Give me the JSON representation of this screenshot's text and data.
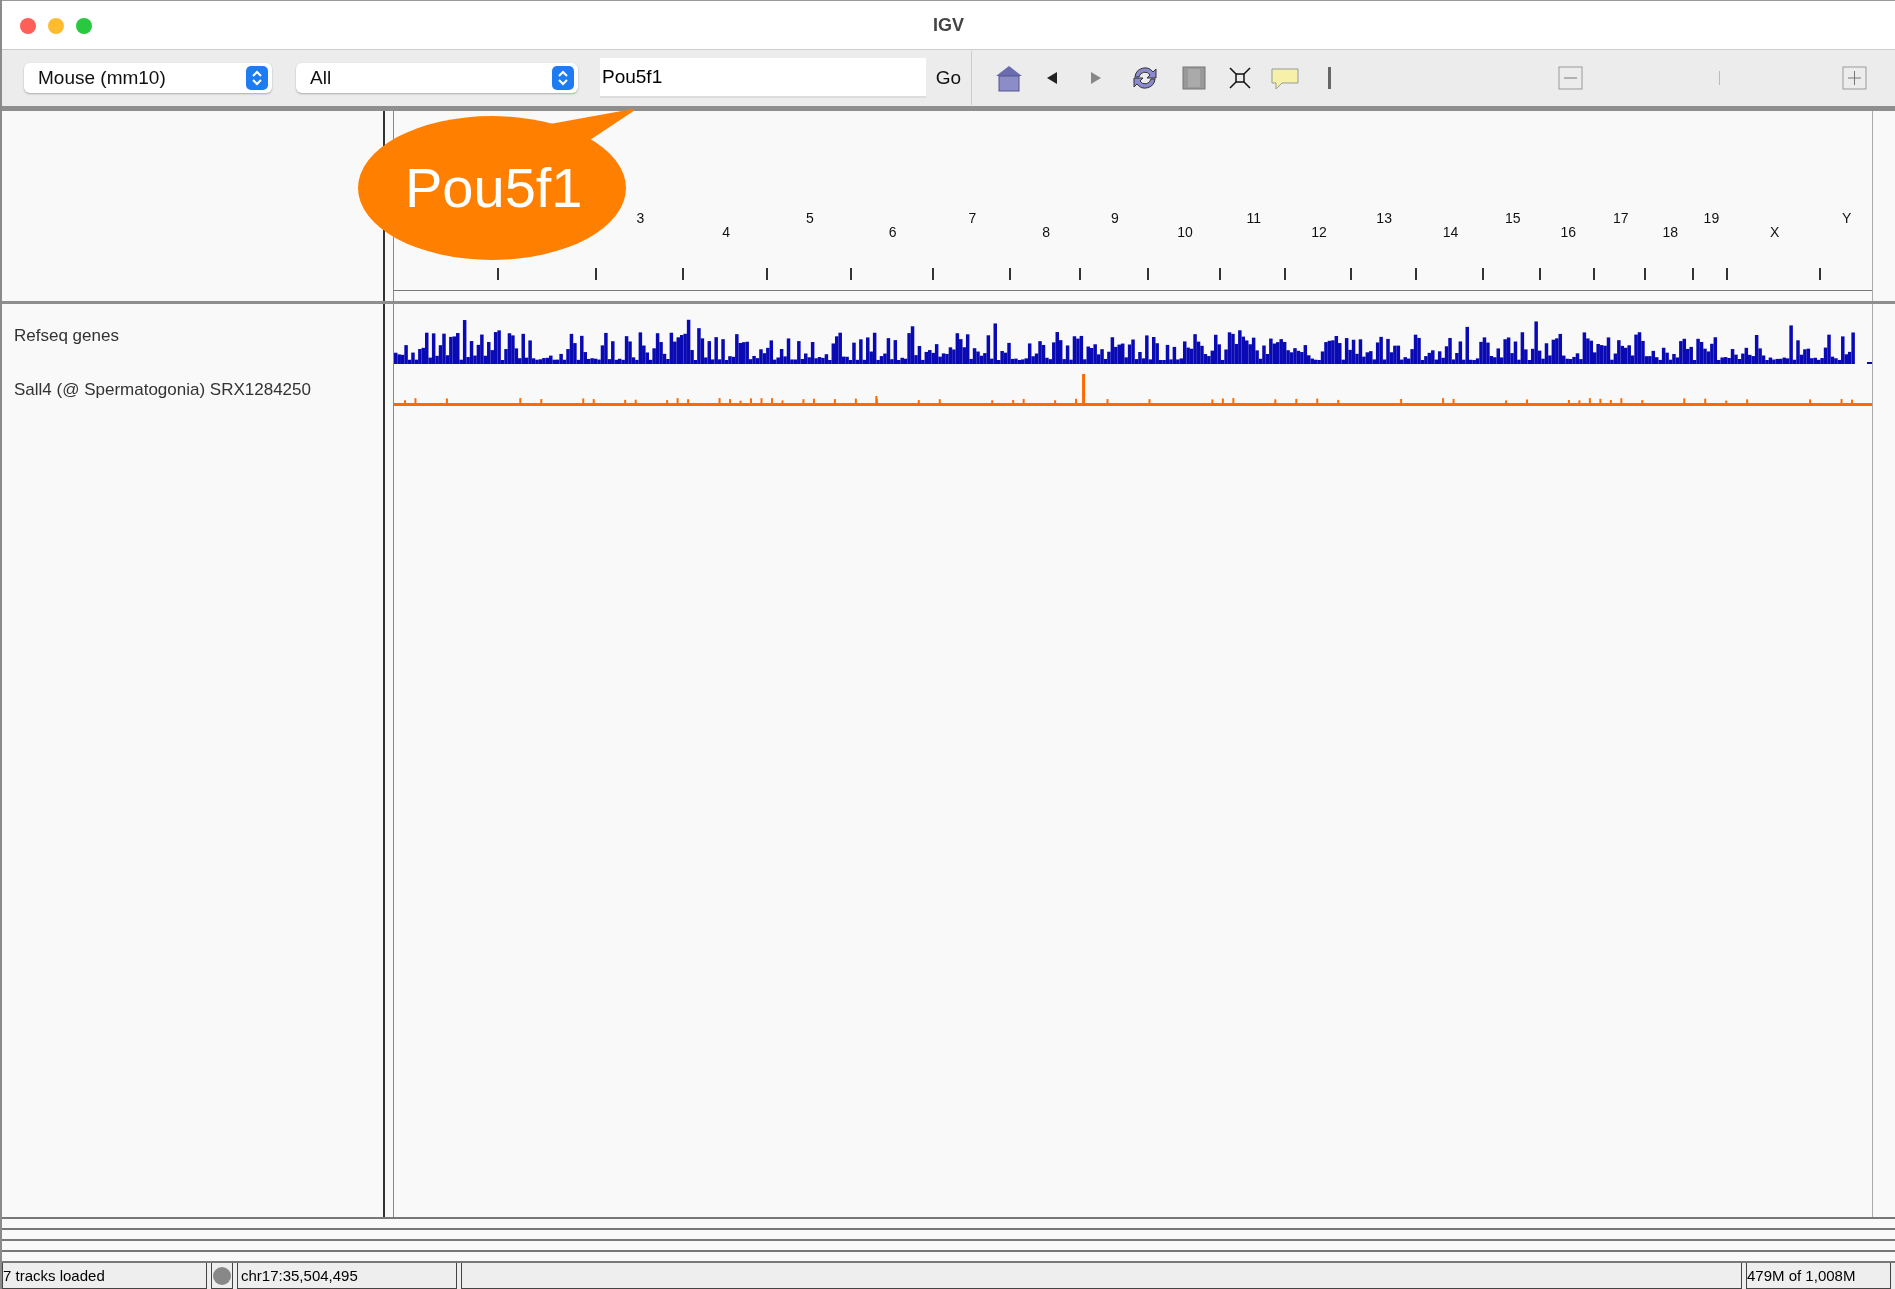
{
  "window": {
    "title": "IGV"
  },
  "toolbar": {
    "genome": "Mouse (mm10)",
    "chromosome": "All",
    "locus": "Pou5f1",
    "go": "Go"
  },
  "callout": {
    "text": "Pou5f1"
  },
  "ruler": {
    "chromosomes": [
      "3",
      "4",
      "5",
      "6",
      "7",
      "8",
      "9",
      "10",
      "11",
      "12",
      "13",
      "14",
      "15",
      "16",
      "17",
      "18",
      "19",
      "X",
      "Y"
    ]
  },
  "tracks": [
    {
      "name": "Refseq genes",
      "kind": "genes",
      "color": "#0a0ab4"
    },
    {
      "name": "Sall4 (@ Spermatogonia) SRX1284250",
      "kind": "signal",
      "color": "#ff6a00"
    }
  ],
  "status_bar": {
    "message": "7 tracks loaded",
    "locus": "chr17:35,504,495",
    "memory": "479M of 1,008M"
  }
}
